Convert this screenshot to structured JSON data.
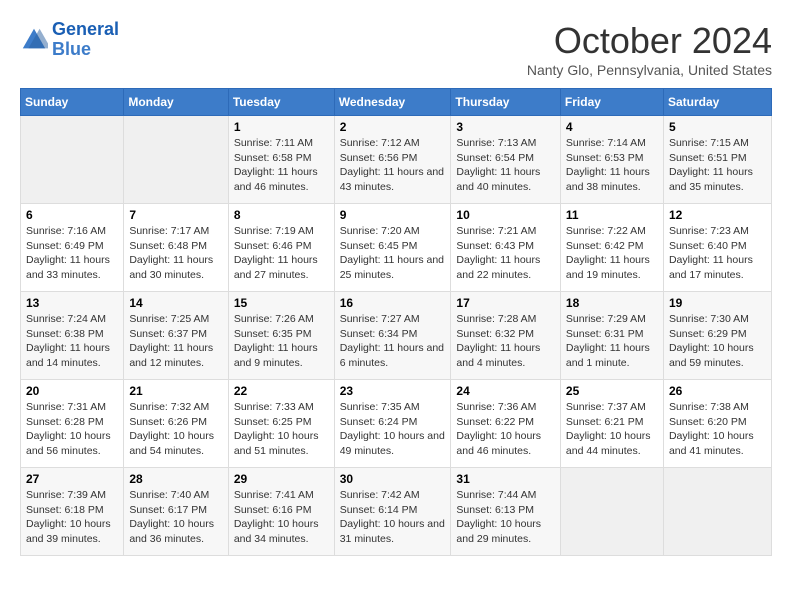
{
  "header": {
    "logo_line1": "General",
    "logo_line2": "Blue",
    "title": "October 2024",
    "location": "Nanty Glo, Pennsylvania, United States"
  },
  "weekdays": [
    "Sunday",
    "Monday",
    "Tuesday",
    "Wednesday",
    "Thursday",
    "Friday",
    "Saturday"
  ],
  "weeks": [
    [
      {
        "day": "",
        "detail": ""
      },
      {
        "day": "",
        "detail": ""
      },
      {
        "day": "1",
        "detail": "Sunrise: 7:11 AM\nSunset: 6:58 PM\nDaylight: 11 hours and 46 minutes."
      },
      {
        "day": "2",
        "detail": "Sunrise: 7:12 AM\nSunset: 6:56 PM\nDaylight: 11 hours and 43 minutes."
      },
      {
        "day": "3",
        "detail": "Sunrise: 7:13 AM\nSunset: 6:54 PM\nDaylight: 11 hours and 40 minutes."
      },
      {
        "day": "4",
        "detail": "Sunrise: 7:14 AM\nSunset: 6:53 PM\nDaylight: 11 hours and 38 minutes."
      },
      {
        "day": "5",
        "detail": "Sunrise: 7:15 AM\nSunset: 6:51 PM\nDaylight: 11 hours and 35 minutes."
      }
    ],
    [
      {
        "day": "6",
        "detail": "Sunrise: 7:16 AM\nSunset: 6:49 PM\nDaylight: 11 hours and 33 minutes."
      },
      {
        "day": "7",
        "detail": "Sunrise: 7:17 AM\nSunset: 6:48 PM\nDaylight: 11 hours and 30 minutes."
      },
      {
        "day": "8",
        "detail": "Sunrise: 7:19 AM\nSunset: 6:46 PM\nDaylight: 11 hours and 27 minutes."
      },
      {
        "day": "9",
        "detail": "Sunrise: 7:20 AM\nSunset: 6:45 PM\nDaylight: 11 hours and 25 minutes."
      },
      {
        "day": "10",
        "detail": "Sunrise: 7:21 AM\nSunset: 6:43 PM\nDaylight: 11 hours and 22 minutes."
      },
      {
        "day": "11",
        "detail": "Sunrise: 7:22 AM\nSunset: 6:42 PM\nDaylight: 11 hours and 19 minutes."
      },
      {
        "day": "12",
        "detail": "Sunrise: 7:23 AM\nSunset: 6:40 PM\nDaylight: 11 hours and 17 minutes."
      }
    ],
    [
      {
        "day": "13",
        "detail": "Sunrise: 7:24 AM\nSunset: 6:38 PM\nDaylight: 11 hours and 14 minutes."
      },
      {
        "day": "14",
        "detail": "Sunrise: 7:25 AM\nSunset: 6:37 PM\nDaylight: 11 hours and 12 minutes."
      },
      {
        "day": "15",
        "detail": "Sunrise: 7:26 AM\nSunset: 6:35 PM\nDaylight: 11 hours and 9 minutes."
      },
      {
        "day": "16",
        "detail": "Sunrise: 7:27 AM\nSunset: 6:34 PM\nDaylight: 11 hours and 6 minutes."
      },
      {
        "day": "17",
        "detail": "Sunrise: 7:28 AM\nSunset: 6:32 PM\nDaylight: 11 hours and 4 minutes."
      },
      {
        "day": "18",
        "detail": "Sunrise: 7:29 AM\nSunset: 6:31 PM\nDaylight: 11 hours and 1 minute."
      },
      {
        "day": "19",
        "detail": "Sunrise: 7:30 AM\nSunset: 6:29 PM\nDaylight: 10 hours and 59 minutes."
      }
    ],
    [
      {
        "day": "20",
        "detail": "Sunrise: 7:31 AM\nSunset: 6:28 PM\nDaylight: 10 hours and 56 minutes."
      },
      {
        "day": "21",
        "detail": "Sunrise: 7:32 AM\nSunset: 6:26 PM\nDaylight: 10 hours and 54 minutes."
      },
      {
        "day": "22",
        "detail": "Sunrise: 7:33 AM\nSunset: 6:25 PM\nDaylight: 10 hours and 51 minutes."
      },
      {
        "day": "23",
        "detail": "Sunrise: 7:35 AM\nSunset: 6:24 PM\nDaylight: 10 hours and 49 minutes."
      },
      {
        "day": "24",
        "detail": "Sunrise: 7:36 AM\nSunset: 6:22 PM\nDaylight: 10 hours and 46 minutes."
      },
      {
        "day": "25",
        "detail": "Sunrise: 7:37 AM\nSunset: 6:21 PM\nDaylight: 10 hours and 44 minutes."
      },
      {
        "day": "26",
        "detail": "Sunrise: 7:38 AM\nSunset: 6:20 PM\nDaylight: 10 hours and 41 minutes."
      }
    ],
    [
      {
        "day": "27",
        "detail": "Sunrise: 7:39 AM\nSunset: 6:18 PM\nDaylight: 10 hours and 39 minutes."
      },
      {
        "day": "28",
        "detail": "Sunrise: 7:40 AM\nSunset: 6:17 PM\nDaylight: 10 hours and 36 minutes."
      },
      {
        "day": "29",
        "detail": "Sunrise: 7:41 AM\nSunset: 6:16 PM\nDaylight: 10 hours and 34 minutes."
      },
      {
        "day": "30",
        "detail": "Sunrise: 7:42 AM\nSunset: 6:14 PM\nDaylight: 10 hours and 31 minutes."
      },
      {
        "day": "31",
        "detail": "Sunrise: 7:44 AM\nSunset: 6:13 PM\nDaylight: 10 hours and 29 minutes."
      },
      {
        "day": "",
        "detail": ""
      },
      {
        "day": "",
        "detail": ""
      }
    ]
  ]
}
